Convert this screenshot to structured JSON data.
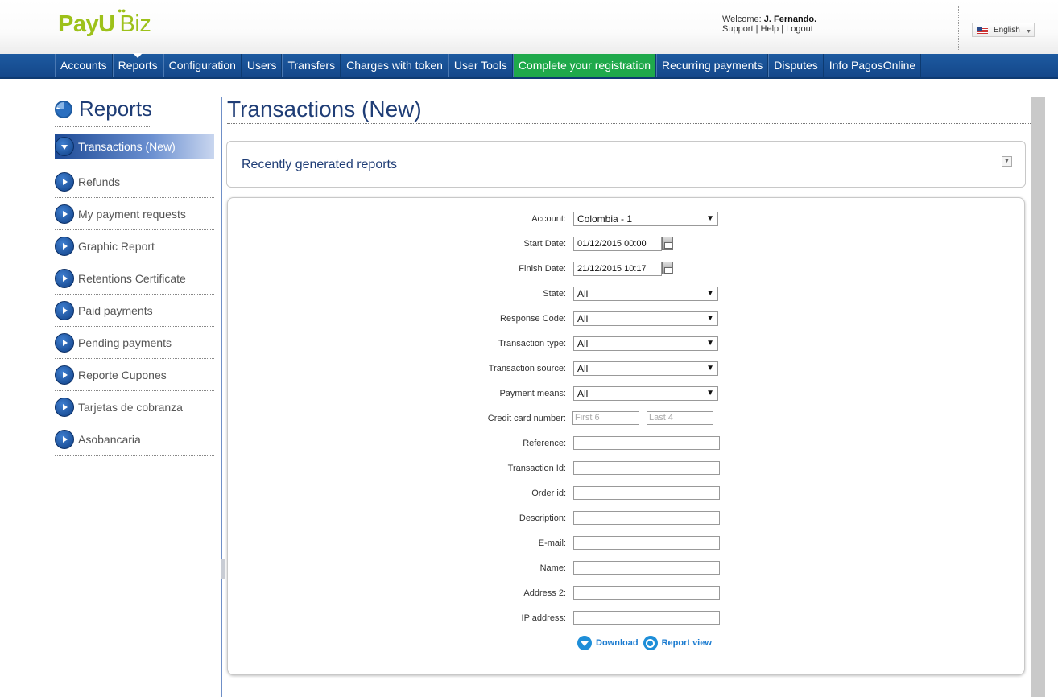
{
  "brand": {
    "logo_main": "PayU",
    "logo_sub": "Biz"
  },
  "header": {
    "welcome_label": "Welcome:",
    "user_name": "J. Fernando.",
    "support": "Support",
    "help": "Help",
    "logout": "Logout",
    "separator": "|",
    "language": "English"
  },
  "nav": {
    "items": [
      "Accounts",
      "Reports",
      "Configuration",
      "Users",
      "Transfers",
      "Charges with token",
      "User Tools",
      "Complete your registration",
      "Recurring payments",
      "Disputes",
      "Info PagosOnline"
    ],
    "active": "Reports",
    "highlight": "Complete your registration"
  },
  "sidebar": {
    "title": "Reports",
    "items": [
      "Transactions (New)",
      "Refunds",
      "My payment requests",
      "Graphic Report",
      "Retentions Certificate",
      "Paid payments",
      "Pending payments",
      "Reporte Cupones",
      "Tarjetas de cobranza",
      "Asobancaria"
    ]
  },
  "main": {
    "title": "Transactions (New)",
    "recent_reports": "Recently generated reports"
  },
  "form": {
    "account": {
      "label": "Account:",
      "value": "Colombia - 1"
    },
    "start_date": {
      "label": "Start Date:",
      "value": "01/12/2015 00:00"
    },
    "finish_date": {
      "label": "Finish Date:",
      "value": "21/12/2015 10:17"
    },
    "state": {
      "label": "State:",
      "value": "All"
    },
    "response_code": {
      "label": "Response Code:",
      "value": "All"
    },
    "transaction_type": {
      "label": "Transaction type:",
      "value": "All"
    },
    "transaction_source": {
      "label": "Transaction source:",
      "value": "All"
    },
    "payment_means": {
      "label": "Payment means:",
      "value": "All"
    },
    "credit_card": {
      "label": "Credit card number:",
      "first_placeholder": "First 6",
      "last_placeholder": "Last 4"
    },
    "reference": {
      "label": "Reference:"
    },
    "transaction_id": {
      "label": "Transaction Id:"
    },
    "order_id": {
      "label": "Order id:"
    },
    "description": {
      "label": "Description:"
    },
    "email": {
      "label": "E-mail:"
    },
    "name": {
      "label": "Name:"
    },
    "address2": {
      "label": "Address 2:"
    },
    "ip_address": {
      "label": "IP address:"
    },
    "download": "Download",
    "report_view": "Report view"
  },
  "colors": {
    "nav_blue": "#1d5aa0",
    "highlight_green": "#1fa94b",
    "title_blue": "#1f3d76",
    "logo_green": "#9dc11a"
  }
}
